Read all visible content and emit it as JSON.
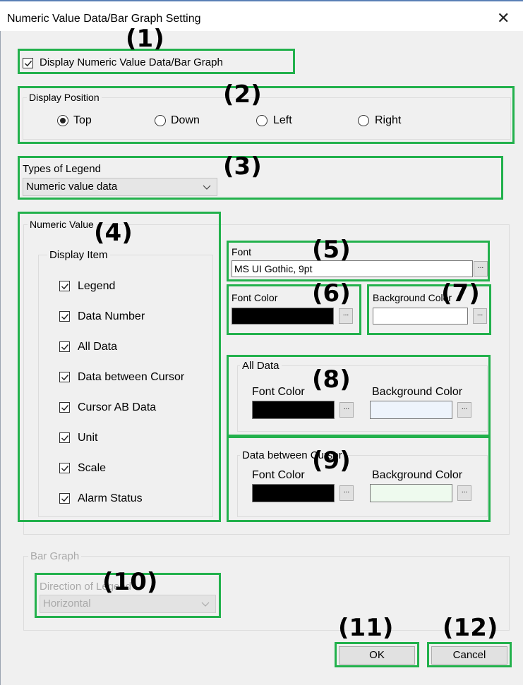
{
  "dialog": {
    "title": "Numeric Value Data/Bar Graph Setting",
    "close_symbol": "✕"
  },
  "display_checkbox": {
    "label": "Display Numeric Value Data/Bar Graph",
    "checked": true
  },
  "display_position": {
    "group_label": "Display Position",
    "options": [
      {
        "label": "Top",
        "selected": true
      },
      {
        "label": "Down",
        "selected": false
      },
      {
        "label": "Left",
        "selected": false
      },
      {
        "label": "Right",
        "selected": false
      }
    ]
  },
  "legend_types": {
    "label": "Types of Legend",
    "value": "Numeric value data"
  },
  "numeric_value": {
    "group_label": "Numeric Value",
    "display_item_label": "Display Item",
    "items": [
      {
        "label": "Legend",
        "checked": true
      },
      {
        "label": "Data Number",
        "checked": true
      },
      {
        "label": "All Data",
        "checked": true
      },
      {
        "label": "Data between Cursor",
        "checked": true
      },
      {
        "label": "Cursor AB Data",
        "checked": true
      },
      {
        "label": "Unit",
        "checked": true
      },
      {
        "label": "Scale",
        "checked": true
      },
      {
        "label": "Alarm Status",
        "checked": true
      }
    ]
  },
  "font": {
    "label": "Font",
    "value": "MS UI Gothic, 9pt"
  },
  "font_color": {
    "label": "Font Color",
    "color": "#000000"
  },
  "background_color": {
    "label": "Background Color",
    "color": "#ffffff"
  },
  "all_data": {
    "group_label": "All Data",
    "font_color_label": "Font Color",
    "background_color_label": "Background Color",
    "font_color": "#000000",
    "background_color": "#eef4fc"
  },
  "data_between_cursor": {
    "group_label": "Data between Cursor",
    "font_color_label": "Font Color",
    "background_color_label": "Background Color",
    "font_color": "#000000",
    "background_color": "#eefaee"
  },
  "bar_graph": {
    "group_label": "Bar Graph",
    "direction_label": "Direction of Legend",
    "direction_value": "Horizontal"
  },
  "ellipsis": "...",
  "buttons": {
    "ok": "OK",
    "cancel": "Cancel"
  },
  "annotations": [
    "(1)",
    "(2)",
    "(3)",
    "(4)",
    "(5)",
    "(6)",
    "(7)",
    "(8)",
    "(9)",
    "(10)",
    "(11)",
    "(12)"
  ],
  "colors": {
    "highlight": "#22b14c",
    "dialog_bg": "#f0f0f0"
  }
}
